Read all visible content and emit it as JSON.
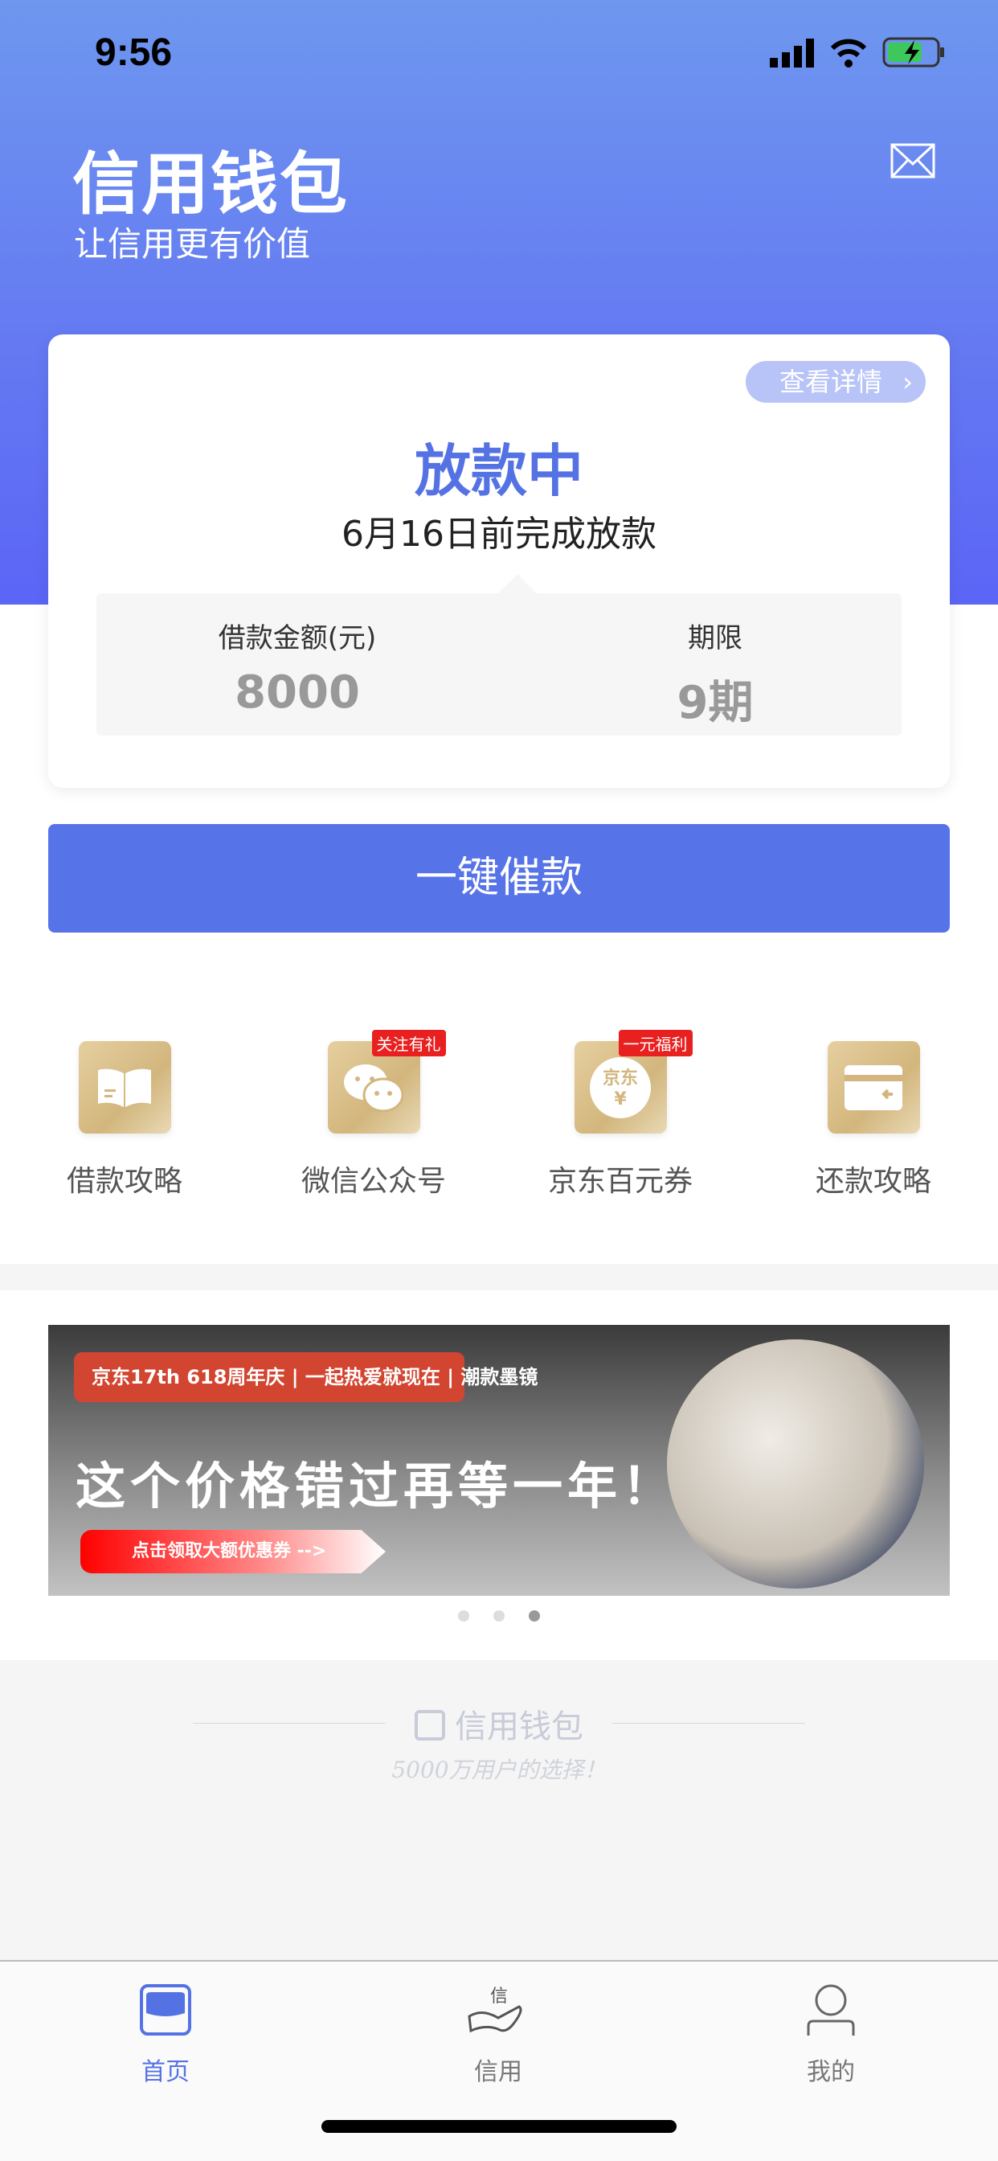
{
  "status_bar": {
    "time": "9:56"
  },
  "header": {
    "title": "信用钱包",
    "subtitle": "让信用更有价值",
    "mail_icon": "mail-icon"
  },
  "loan_card": {
    "details_label": "查看详情",
    "status": "放款中",
    "date_text": "6月16日前完成放款",
    "amount_label": "借款金额(元)",
    "amount_value": "8000",
    "term_label": "期限",
    "term_value": "9期"
  },
  "urge_button": "一键催款",
  "entries": [
    {
      "label": "借款攻略",
      "icon": "book-icon"
    },
    {
      "label": "微信公众号",
      "icon": "wechat-icon",
      "badge": "关注有礼"
    },
    {
      "label": "京东百元券",
      "icon": "jd-coupon-icon",
      "badge": "一元福利",
      "icon_text": "京东"
    },
    {
      "label": "还款攻略",
      "icon": "card-icon"
    }
  ],
  "banner": {
    "top_text": "京东17th 618周年庆 | 一起热爱就现在 | 潮款墨镜",
    "slogan": "这个价格错过再等一年！",
    "cta": "点击领取大额优惠券 -->",
    "active_slide": 3,
    "slide_count": 3
  },
  "footer": {
    "logo": "信用钱包",
    "slogan": "5000万用户的选择！"
  },
  "tabs": [
    {
      "label": "首页",
      "active": true
    },
    {
      "label": "信用"
    },
    {
      "label": "我的"
    }
  ],
  "colors": {
    "accent": "#5572e4",
    "button": "#5773e8",
    "badge": "#e82020",
    "gold": "#d2b67d"
  }
}
